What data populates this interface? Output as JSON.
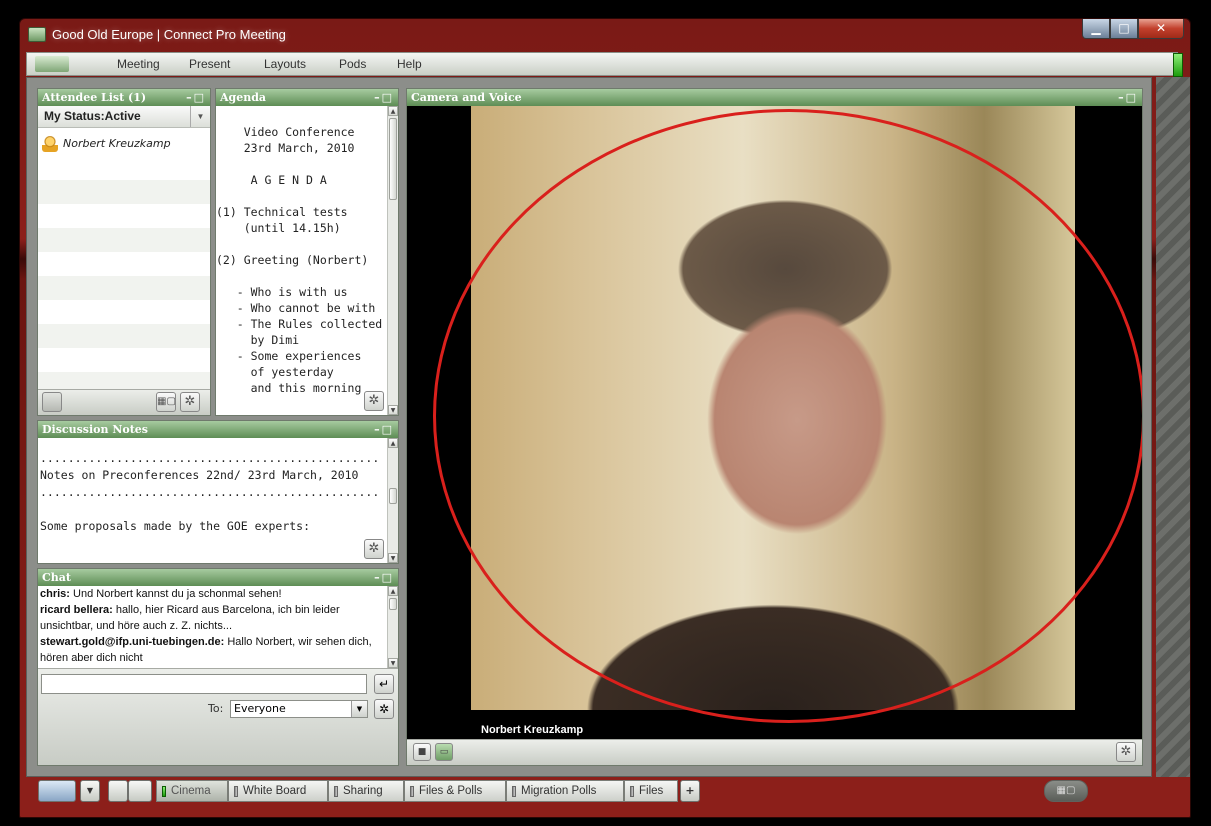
{
  "window": {
    "title": "Good Old Europe | Connect Pro Meeting",
    "min_glyph": "▁",
    "max_glyph": "□",
    "close_glyph": "✕"
  },
  "menu": {
    "items": [
      "Meeting",
      "Present",
      "Layouts",
      "Pods",
      "Help"
    ]
  },
  "pods": {
    "attendee": {
      "title": "Attendee List (1)",
      "controls": "–□",
      "status": "My Status:Active",
      "attendees": [
        "Norbert Kreuzkamp"
      ]
    },
    "agenda": {
      "title": "Agenda",
      "controls": "–□",
      "text": "    Video Conference\n    23rd March, 2010\n\n     A G E N D A\n\n(1) Technical tests\n    (until 14.15h)\n\n(2) Greeting (Norbert)\n\n   - Who is with us\n   - Who cannot be with\n   - The Rules collected\n     by Dimi\n   - Some experiences\n     of yesterday\n     and this morning"
    },
    "notes": {
      "title": "Discussion Notes",
      "controls": "–□",
      "text": ".................................................\nNotes on Preconferences 22nd/ 23rd March, 2010\n.................................................\n\nSome proposals made by the GOE experts:"
    },
    "chat": {
      "title": "Chat",
      "controls": "–□",
      "messages": [
        {
          "sender": "chris:",
          "text": " Und Norbert kannst du ja schonmal sehen!"
        },
        {
          "sender": "ricard bellera:",
          "text": " hallo, hier Ricard aus Barcelona, ich bin leider unsichtbar, und höre auch z. Z. nichts..."
        },
        {
          "sender": "stewart.gold@ifp.uni-tuebingen.de:",
          "text": " Hallo Norbert, wir sehen dich, hören aber dich nicht"
        }
      ],
      "input_value": "",
      "to_label": "To:",
      "to_value": "Everyone"
    },
    "camera": {
      "title": "Camera and Voice",
      "controls": "–□",
      "video_label": "Norbert Kreuzkamp"
    }
  },
  "icons": {
    "gear": "✲",
    "enter": "↵",
    "caret": "▼",
    "scroll_up": "▲",
    "scroll_down": "▼",
    "stop": "■",
    "cam": "▭",
    "plus": "+",
    "layout": "▦▢"
  },
  "taskbar": {
    "tabs": [
      {
        "label": "Cinema",
        "active": true
      },
      {
        "label": "White Board",
        "active": false
      },
      {
        "label": "Sharing",
        "active": false
      },
      {
        "label": "Files & Polls",
        "active": false
      },
      {
        "label": "Migration Polls",
        "active": false
      },
      {
        "label": "Files",
        "active": false
      }
    ]
  },
  "colors": {
    "pod_header": "#5e8d55",
    "annotation_circle": "#d9201c",
    "active_tab_indicator": "#1c9d0b"
  }
}
